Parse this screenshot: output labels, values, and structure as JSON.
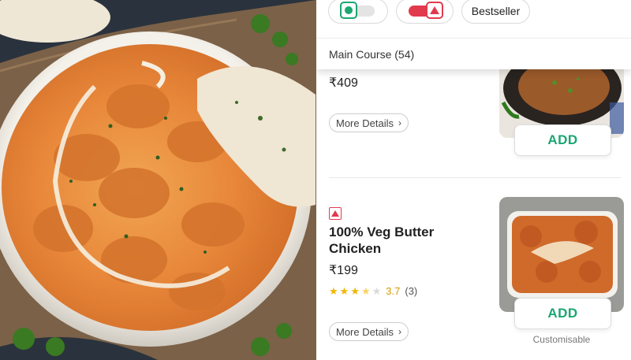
{
  "filters": {
    "veg_toggle": "veg-toggle",
    "nonveg_toggle": "nonveg-toggle",
    "bestseller_label": "Bestseller"
  },
  "section": {
    "title": "Main Course (54)"
  },
  "items": [
    {
      "price": "₹409",
      "more_details": "More Details",
      "add_label": "ADD",
      "type": "veg"
    },
    {
      "type": "non-veg",
      "name": "100% Veg Butter Chicken",
      "price": "₹199",
      "rating": "3.7",
      "rating_stars": 3.5,
      "rating_count": "(3)",
      "more_details": "More Details",
      "add_label": "ADD",
      "customisable": "Customisable"
    }
  ],
  "colors": {
    "veg_green": "#1ba672",
    "nonveg_red": "#e23a4d",
    "add_green": "#1ba672",
    "star_yellow": "#f2b600"
  },
  "icons": [
    "veg-circle-icon",
    "nonveg-triangle-icon",
    "chevron-right-icon",
    "star-icon"
  ]
}
